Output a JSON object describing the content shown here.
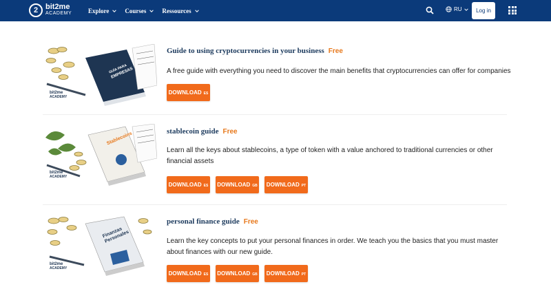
{
  "header": {
    "logo": {
      "badge": "2",
      "brand": "bit2me",
      "sub": "ACADEMY"
    },
    "nav": [
      {
        "label": "Explore"
      },
      {
        "label": "Courses"
      },
      {
        "label": "Ressources"
      }
    ],
    "language": "RU",
    "login_label": "Log in",
    "colors": {
      "bar": "#0b3a7a",
      "accent": "#f16a1b",
      "free": "#e7781b"
    }
  },
  "guides": [
    {
      "title": "Guide to using cryptocurrencies in your business",
      "badge": "Free",
      "description": "A free guide with everything you need to discover the main benefits that cryptocurrencies can offer for companies",
      "cover_lines": [
        "GUÍA PARA",
        "EMPRESAS"
      ],
      "brand": "bit2me",
      "brand_sub": "ACADEMY",
      "buttons": [
        {
          "label": "DOWNLOAD",
          "code": "ES"
        }
      ]
    },
    {
      "title": "stablecoin guide",
      "badge": "Free",
      "description": "Learn all the keys about stablecoins, a type of token with a value anchored to traditional currencies or other financial assets",
      "cover_lines": [
        "Stablecoins"
      ],
      "brand": "bit2me",
      "brand_sub": "ACADEMY",
      "buttons": [
        {
          "label": "DOWNLOAD",
          "code": "ES"
        },
        {
          "label": "DOWNLOAD",
          "code": "GB"
        },
        {
          "label": "DOWNLOAD",
          "code": "PT"
        }
      ]
    },
    {
      "title": "personal finance guide",
      "badge": "Free",
      "description": "Learn the key concepts to put your personal finances in order. We teach you the basics that you must master about finances with our new guide.",
      "cover_lines": [
        "Finanzas",
        "Personales"
      ],
      "brand": "bit2me",
      "brand_sub": "ACADEMY",
      "buttons": [
        {
          "label": "DOWNLOAD",
          "code": "ES"
        },
        {
          "label": "DOWNLOAD",
          "code": "GB"
        },
        {
          "label": "DOWNLOAD",
          "code": "PT"
        }
      ]
    }
  ]
}
